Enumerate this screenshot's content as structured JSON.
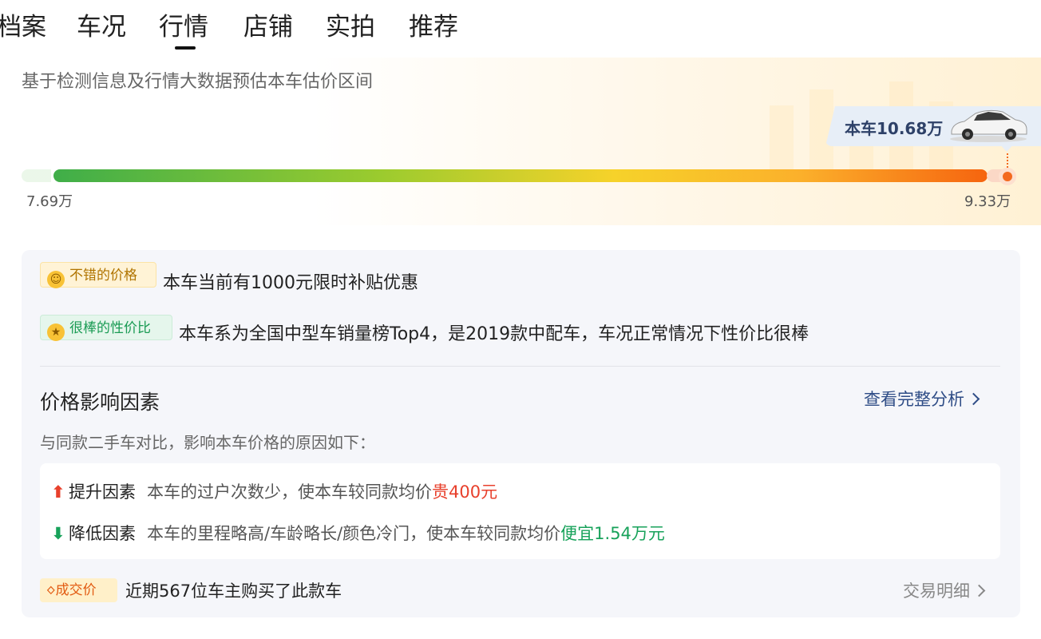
{
  "tabs": [
    {
      "label": "档案"
    },
    {
      "label": "车况"
    },
    {
      "label": "行情",
      "active": true
    },
    {
      "label": "店铺"
    },
    {
      "label": "实拍"
    },
    {
      "label": "推荐"
    }
  ],
  "estimate": {
    "subtitle": "基于检测信息及行情大数据预估本车估价区间",
    "car_price_label": "本车10.68万",
    "range_low": "7.69万",
    "range_high": "9.33万"
  },
  "highlights": [
    {
      "tag": "不错的价格",
      "text": "本车当前有1000元限时补贴优惠"
    },
    {
      "tag": "很棒的性价比",
      "text": "本车系为全国中型车销量榜Top4，是2019款中配车，车况正常情况下性价比很棒"
    }
  ],
  "factors_section": {
    "title": "价格影响因素",
    "link": "查看完整分析",
    "subtitle": "与同款二手车对比，影响本车价格的原因如下：",
    "items": [
      {
        "label": "提升因素",
        "desc": "本车的过户次数少，使本车较同款均价",
        "highlight": "贵400元"
      },
      {
        "label": "降低因素",
        "desc": "本车的里程略高/车龄略长/颜色冷门，使本车较同款均价",
        "highlight": "便宜1.54万元"
      }
    ]
  },
  "deal": {
    "tag": "成交价",
    "text": "近期567位车主购买了此款车",
    "link": "交易明细"
  },
  "colors": {
    "accent_orange": "#f36a1f",
    "up_red": "#e8402c",
    "down_green": "#17a25a",
    "link_blue": "#2e4c86"
  }
}
